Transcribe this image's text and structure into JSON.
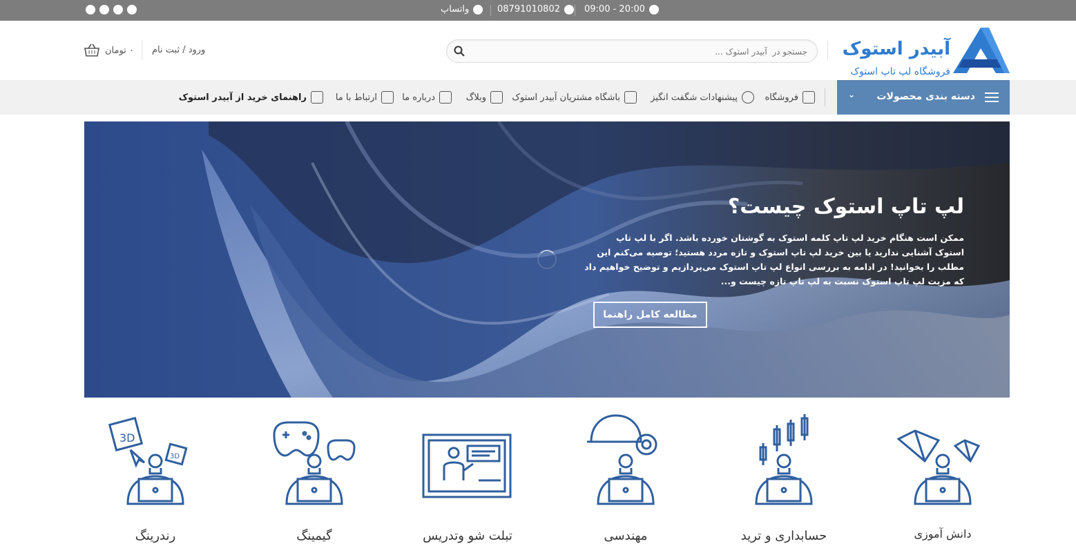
{
  "topbar": {
    "hours": "09:00 - 20:00",
    "phone": "08791010802",
    "whatsapp": "واتساپ",
    "social_icons": [
      "instagram-icon",
      "phone-icon",
      "youtube-icon",
      "telegram-icon"
    ]
  },
  "header": {
    "logo_title": "آبیدر استوک",
    "logo_subtitle": "فروشگاه لپ تاپ استوک",
    "search_placeholder": "جستجو در  آبیدر استوک ...",
    "login": "ورود / ثبت نام",
    "cart_total": "۰ تومان"
  },
  "nav": {
    "categories": "دسته بندی محصولات",
    "items": [
      {
        "label": "فروشگاه",
        "icon": "store-icon"
      },
      {
        "label": "پیشنهادات شگفت انگیز",
        "icon": "discount-icon"
      },
      {
        "label": "باشگاه مشتریان آبیدر استوک",
        "icon": "tag-icon"
      },
      {
        "label": "وبلاگ",
        "icon": "blog-icon"
      },
      {
        "label": "درباره ما",
        "icon": "about-icon"
      },
      {
        "label": "ارتباط با ما",
        "icon": "contact-icon"
      },
      {
        "label": "راهنمای خرید از آبیدر استوک",
        "icon": "guide-icon"
      }
    ]
  },
  "hero": {
    "title": "لپ تاپ استوک چیست؟",
    "text": "ممکن است هنگام خرید لپ تاپ کلمه استوک به گوشتان خورده باشد. اگر با لپ تاپ استوک آشنایی ندارید یا بین خرید لپ تاپ استوک و تازه مردد هستید؛ توصیه می‌کنم این مطلب را بخوانید! در ادامه به بررسی انواع لپ تاپ استوک می‌پردازیم و توضیح خواهیم داد که مزیت لپ تاپ استوک نسبت به لپ تاپ تازه چیست و...",
    "button": "مطالعه کامل راهنما"
  },
  "categories": [
    {
      "label": "رندرینگ",
      "icon": "rendering-icon"
    },
    {
      "label": "گیمینگ",
      "icon": "gaming-icon"
    },
    {
      "label": "تبلت شو وتدریس",
      "icon": "teaching-icon"
    },
    {
      "label": "مهندسی",
      "icon": "engineering-icon"
    },
    {
      "label": "حسابداری و ترید",
      "icon": "trading-icon"
    },
    {
      "label": "دانش آموزی",
      "icon": "student-icon"
    }
  ],
  "colors": {
    "brand": "#2f7bd0",
    "nav_accent": "#5a86b5",
    "topbar": "#7d7d7d",
    "icon_blue": "#2f5f9f"
  }
}
